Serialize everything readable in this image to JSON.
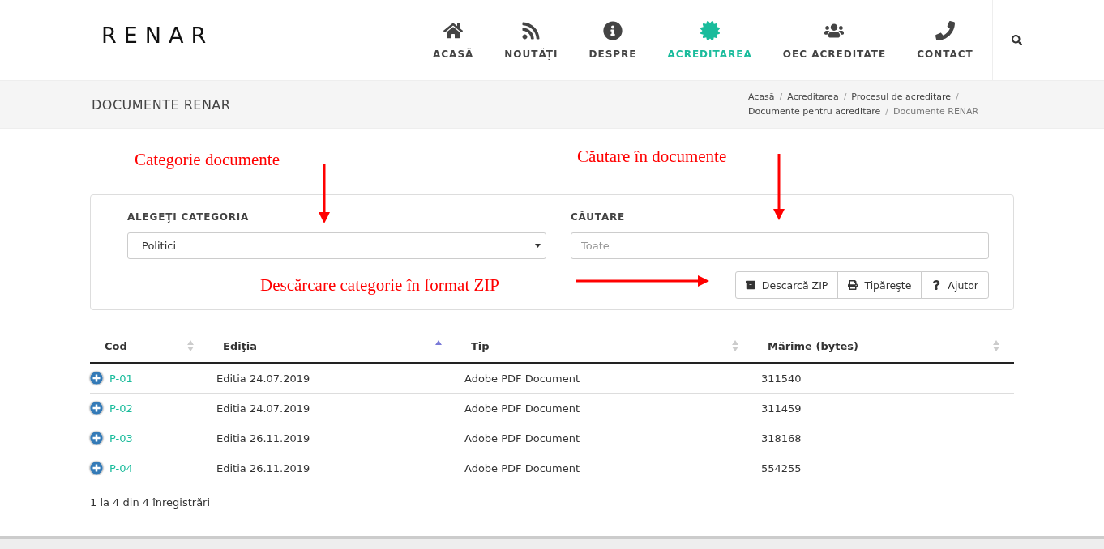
{
  "logo": "RENAR",
  "nav": [
    {
      "label": "ACASĂ",
      "selected": false
    },
    {
      "label": "NOUTĂŢI",
      "selected": false
    },
    {
      "label": "DESPRE",
      "selected": false
    },
    {
      "label": "ACREDITAREA",
      "selected": true
    },
    {
      "label": "OEC ACREDITATE",
      "selected": false
    },
    {
      "label": "CONTACT",
      "selected": false
    }
  ],
  "page_title": "DOCUMENTE RENAR",
  "breadcrumb_separator": "/",
  "breadcrumb": [
    {
      "label": "Acasă",
      "current": false
    },
    {
      "label": "Acreditarea",
      "current": false
    },
    {
      "label": "Procesul de acreditare",
      "current": false
    },
    {
      "label": "Documente pentru acreditare",
      "current": false
    },
    {
      "label": "Documente RENAR",
      "current": true
    }
  ],
  "annotations": [
    {
      "text": "Categorie documente"
    },
    {
      "text": "Căutare în documente"
    },
    {
      "text": "Descărcare categorie în format ZIP"
    }
  ],
  "filters": {
    "category_label": "ALEGEŢI CATEGORIA",
    "category_value": "Politici",
    "search_label": "CĂUTARE",
    "search_placeholder": "Toate"
  },
  "buttons": [
    {
      "label": "Descarcă ZIP"
    },
    {
      "label": "Tipăreşte"
    },
    {
      "label": "Ajutor"
    }
  ],
  "table": {
    "columns": [
      {
        "label": "Cod",
        "sorted": false
      },
      {
        "label": "Ediţia",
        "sorted": true
      },
      {
        "label": "Tip",
        "sorted": false
      },
      {
        "label": "Mărime (bytes)",
        "sorted": false
      }
    ],
    "rows": [
      [
        "P-01",
        "Editia 24.07.2019",
        "Adobe PDF Document",
        "311540"
      ],
      [
        "P-02",
        "Editia 24.07.2019",
        "Adobe PDF Document",
        "311459"
      ],
      [
        "P-03",
        "Editia 26.11.2019",
        "Adobe PDF Document",
        "318168"
      ],
      [
        "P-04",
        "Editia 26.11.2019",
        "Adobe PDF Document",
        "554255"
      ]
    ]
  },
  "table_info": "1 la 4 din 4 înregistrări"
}
